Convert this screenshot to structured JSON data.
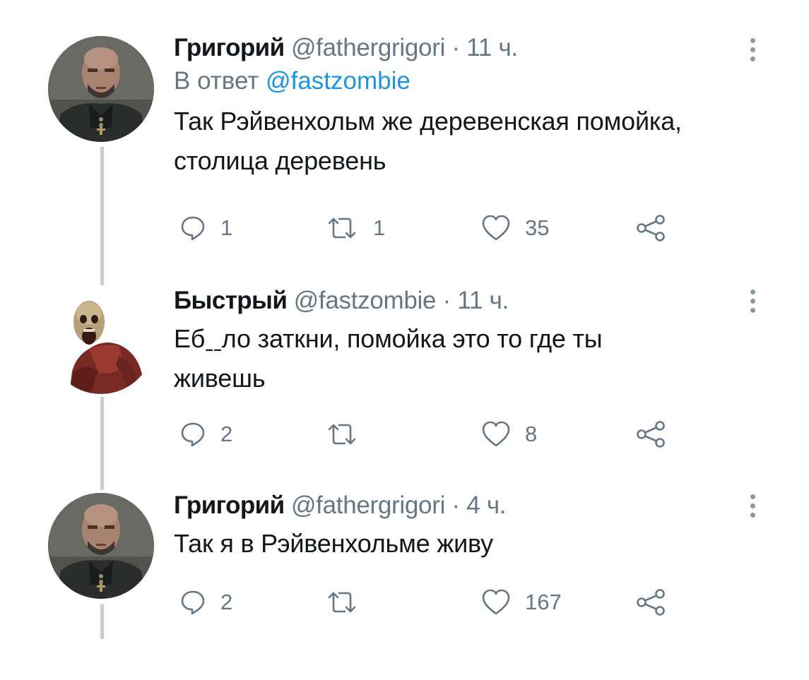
{
  "tweets": [
    {
      "author_name": "Григорий",
      "handle": "@fathergrigori",
      "separator": "·",
      "time": "11 ч.",
      "reply_prefix": "В ответ",
      "reply_mention": "@fastzombie",
      "text_line1": "Так Рэйвенхольм же деревенская помойка,",
      "text_line2": "столица деревень",
      "replies": "1",
      "retweets": "1",
      "likes": "35",
      "avatar": "grigori-avatar"
    },
    {
      "author_name": "Быстрый",
      "handle": "@fastzombie",
      "separator": "·",
      "time": "11 ч.",
      "text_line1": "Ебˍˍло заткни, помойка это то где ты",
      "text_line2": "живешь",
      "replies": "2",
      "retweets": "",
      "likes": "8",
      "avatar": "fast-zombie-avatar"
    },
    {
      "author_name": "Григорий",
      "handle": "@fathergrigori",
      "separator": "·",
      "time": "4 ч.",
      "text_line1": "Так я в Рэйвенхольме живу",
      "replies": "2",
      "retweets": "",
      "likes": "167",
      "avatar": "grigori-avatar"
    }
  ],
  "icons": {
    "reply": "speech-bubble-icon",
    "retweet": "retweet-arrows-icon",
    "like": "heart-outline-icon",
    "share": "share-nodes-icon",
    "more": "vertical-ellipsis-icon"
  },
  "colors": {
    "text": "#14171a",
    "secondary": "#657786",
    "link": "#1b95e0",
    "thread_line": "#c8d0d7"
  }
}
